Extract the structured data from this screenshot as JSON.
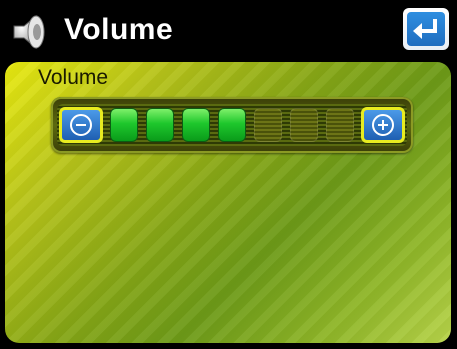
{
  "header": {
    "title": "Volume",
    "speaker_icon": "speaker-icon",
    "back_icon": "enter-return-icon"
  },
  "panel": {
    "label": "Volume"
  },
  "volume": {
    "total_segments": 7,
    "filled_segments": 4,
    "level_fraction": 0.571,
    "minus_icon": "minus-circle-icon",
    "plus_icon": "plus-circle-icon"
  },
  "colors": {
    "header_bg": "#000000",
    "segment_on": "#1ec72c",
    "button_blue": "#2f8fe0",
    "button_border": "#e8ec20"
  }
}
